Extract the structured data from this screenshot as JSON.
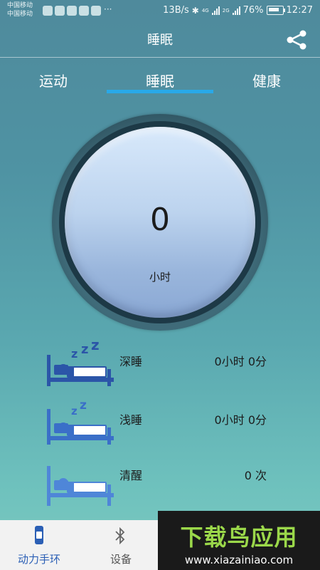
{
  "status_bar": {
    "carrier_1": "中国移动",
    "carrier_2": "中国移动",
    "more": "···",
    "speed": "13B/s",
    "net_1": "4G",
    "net_2": "2G",
    "battery": "76%",
    "time": "12:27"
  },
  "header": {
    "title": "睡眠",
    "share_icon": "share-icon"
  },
  "tabs": [
    {
      "label": "运动",
      "active": false
    },
    {
      "label": "睡眠",
      "active": true
    },
    {
      "label": "健康",
      "active": false
    }
  ],
  "dial": {
    "value": "0",
    "unit": "小时"
  },
  "rows": [
    {
      "label": "深睡",
      "value": "0小时 0分"
    },
    {
      "label": "浅睡",
      "value": "0小时 0分"
    },
    {
      "label": "清醒",
      "value": "0 次"
    }
  ],
  "bottom_nav": [
    {
      "label": "动力手环",
      "icon": "band-icon"
    },
    {
      "label": "设备",
      "icon": "bluetooth-icon"
    }
  ],
  "watermark": {
    "text": "下载鸟应用",
    "url": "www.xiazainiao.com"
  },
  "colors": {
    "accent": "#29a9e8",
    "deep_sleep": "#2b55a8",
    "light_sleep": "#3a6fc8",
    "awake": "#4f86d8",
    "watermark_green": "#9bd84a"
  }
}
